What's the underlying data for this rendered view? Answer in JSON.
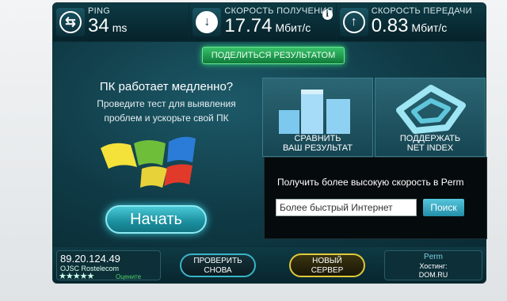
{
  "metrics": {
    "ping": {
      "label": "PING",
      "value": "34",
      "unit": "ms",
      "icon": "ping-icon"
    },
    "download": {
      "label": "СКОРОСТЬ ПОЛУЧЕНИЯ",
      "value": "17.74",
      "unit": "Мбит/с",
      "icon": "download-arrow-icon"
    },
    "upload": {
      "label": "СКОРОСТЬ ПЕРЕДАЧИ",
      "value": "0.83",
      "unit": "Мбит/с",
      "icon": "upload-arrow-icon"
    }
  },
  "share": {
    "label": "ПОДЕЛИТЬСЯ РЕЗУЛЬТАТОМ"
  },
  "promo": {
    "title": "ПК работает медленно?",
    "line1": "Проведите тест для выявления",
    "line2": "проблем и ускорьте свой ПК",
    "start_label": "Начать"
  },
  "tiles": {
    "compare_line1": "СРАВНИТЬ",
    "compare_line2": "ВАШ РЕЗУЛЬТАТ",
    "support_line1": "ПОДДЕРЖАТЬ",
    "support_line2": "NET INDEX"
  },
  "popup": {
    "title": "Получить более высокую скорость в Perm",
    "input_value": "Более быстрый Интернет",
    "search_label": "Поиск"
  },
  "bottom": {
    "ip": "89.20.124.49",
    "isp": "OJSC Rostelecom",
    "stars": "★★★★★",
    "rate_label": "Оцените",
    "retest_line1": "ПРОВЕРИТЬ",
    "retest_line2": "СНОВА",
    "newserver_line1": "НОВЫЙ",
    "newserver_line2": "СЕРВЕР",
    "server_city": "Perm",
    "server_host_label": "Хостинг:",
    "server_host": "DOM.RU"
  },
  "colors": {
    "accent_green": "#38c26a",
    "accent_cyan": "#39b4c8",
    "accent_gold": "#e0c93a",
    "panel_bg": "#0f3a45"
  }
}
